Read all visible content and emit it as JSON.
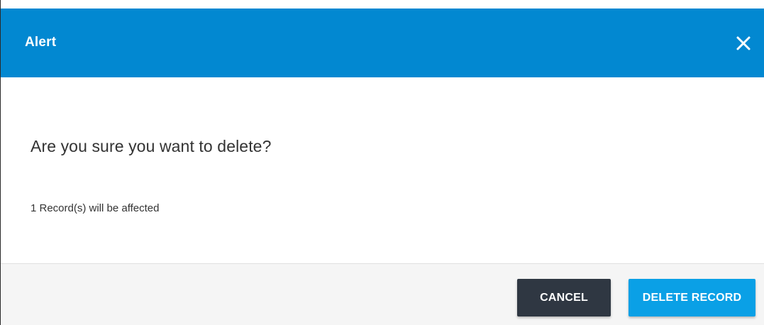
{
  "dialog": {
    "title": "Alert",
    "close_icon": "close-icon",
    "message": "Are you sure you want to delete?",
    "detail": "1 Record(s) will be affected",
    "buttons": {
      "cancel_label": "CANCEL",
      "delete_label": "DELETE RECORD"
    }
  },
  "colors": {
    "header": "#0288d1",
    "cancel_button": "#2f3742",
    "delete_button": "#0aa0e6",
    "footer": "#f5f5f5"
  }
}
